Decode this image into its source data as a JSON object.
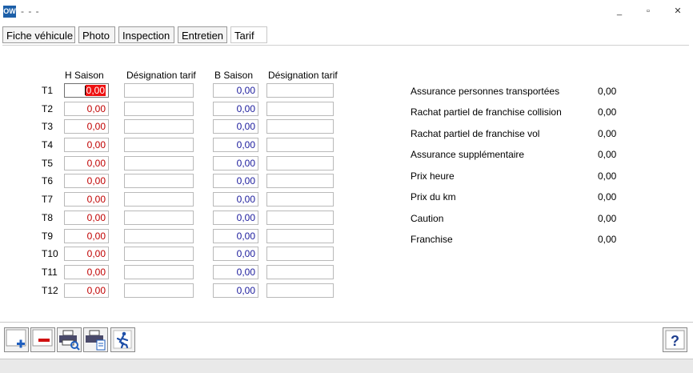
{
  "window": {
    "app_icon_text": "OW",
    "title": "- - -",
    "minimize_glyph": "_",
    "maximize_glyph": "▫",
    "close_glyph": "✕"
  },
  "tabs": [
    {
      "label": "Fiche véhicule"
    },
    {
      "label": "Photo"
    },
    {
      "label": "Inspection"
    },
    {
      "label": "Entretien"
    },
    {
      "label": "Tarif",
      "active": true
    }
  ],
  "tarif": {
    "headers": {
      "h_saison": "H Saison",
      "designation_1": "Désignation tarif",
      "b_saison": "B Saison",
      "designation_2": "Désignation tarif"
    },
    "rows": [
      {
        "label": "T1",
        "h_saison": "0,00",
        "designation_1": "",
        "b_saison": "0,00",
        "designation_2": ""
      },
      {
        "label": "T2",
        "h_saison": "0,00",
        "designation_1": "",
        "b_saison": "0,00",
        "designation_2": ""
      },
      {
        "label": "T3",
        "h_saison": "0,00",
        "designation_1": "",
        "b_saison": "0,00",
        "designation_2": ""
      },
      {
        "label": "T4",
        "h_saison": "0,00",
        "designation_1": "",
        "b_saison": "0,00",
        "designation_2": ""
      },
      {
        "label": "T5",
        "h_saison": "0,00",
        "designation_1": "",
        "b_saison": "0,00",
        "designation_2": ""
      },
      {
        "label": "T6",
        "h_saison": "0,00",
        "designation_1": "",
        "b_saison": "0,00",
        "designation_2": ""
      },
      {
        "label": "T7",
        "h_saison": "0,00",
        "designation_1": "",
        "b_saison": "0,00",
        "designation_2": ""
      },
      {
        "label": "T8",
        "h_saison": "0,00",
        "designation_1": "",
        "b_saison": "0,00",
        "designation_2": ""
      },
      {
        "label": "T9",
        "h_saison": "0,00",
        "designation_1": "",
        "b_saison": "0,00",
        "designation_2": ""
      },
      {
        "label": "T10",
        "h_saison": "0,00",
        "designation_1": "",
        "b_saison": "0,00",
        "designation_2": ""
      },
      {
        "label": "T11",
        "h_saison": "0,00",
        "designation_1": "",
        "b_saison": "0,00",
        "designation_2": ""
      },
      {
        "label": "T12",
        "h_saison": "0,00",
        "designation_1": "",
        "b_saison": "0,00",
        "designation_2": ""
      }
    ]
  },
  "options": [
    {
      "label": "Assurance personnes transportées",
      "value": "0,00"
    },
    {
      "label": "Rachat partiel de franchise collision",
      "value": "0,00"
    },
    {
      "label": "Rachat partiel de franchise vol",
      "value": "0,00"
    },
    {
      "label": "Assurance supplémentaire",
      "value": "0,00"
    },
    {
      "label": "Prix heure",
      "value": "0,00"
    },
    {
      "label": "Prix du km",
      "value": "0,00"
    },
    {
      "label": "Caution",
      "value": "0,00"
    },
    {
      "label": "Franchise",
      "value": "0,00"
    }
  ],
  "toolbar": {
    "buttons": [
      {
        "name": "add-button",
        "icon": "plus-icon"
      },
      {
        "name": "delete-button",
        "icon": "minus-icon"
      },
      {
        "name": "print-preview-button",
        "icon": "printer-magnifier-icon"
      },
      {
        "name": "print-export-button",
        "icon": "printer-document-icon"
      },
      {
        "name": "exit-button",
        "icon": "running-man-icon"
      }
    ],
    "help_label": "?"
  },
  "colors": {
    "h_saison_text": "#c00000",
    "b_saison_text": "#1a1a9c",
    "selection": "#ee1111",
    "app_icon": "#1c5fa8"
  }
}
